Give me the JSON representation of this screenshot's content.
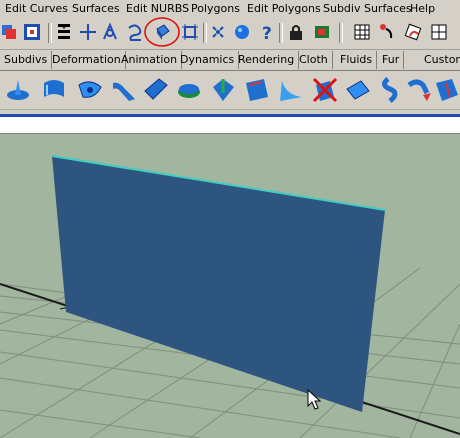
{
  "menu": {
    "items": [
      "Edit Curves",
      "Surfaces",
      "Edit NURBS",
      "Polygons",
      "Edit Polygons",
      "Subdiv Surfaces",
      "Help"
    ]
  },
  "shelf_tabs": [
    "Subdivs",
    "Deformation",
    "Animation",
    "Dynamics",
    "Rendering",
    "Cloth",
    "Fluids",
    "Fur",
    "Custom"
  ],
  "toolbar": {
    "icons": [
      "select-mode-icon",
      "hierarchy-mode-icon",
      "object-mode-icon",
      "pick-mask-icon",
      "snap-grid-icon",
      "snap-curve-icon",
      "snap-point-icon",
      "snap-view-plane-icon",
      "make-live-icon",
      "history-icon",
      "render-icon",
      "help-icon",
      "lock-icon",
      "ipr-render-icon",
      "render-settings-icon",
      "hypershade-icon",
      "shader-icon"
    ]
  },
  "shelf": {
    "icons": [
      "revolve-icon",
      "loft-icon",
      "planar-icon",
      "extrude-icon",
      "birail-icon",
      "boundary-icon",
      "square-icon",
      "bevel-icon",
      "bevel-plus-icon",
      "intersect-icon",
      "trim-icon",
      "untrim-icon",
      "attach-icon",
      "detach-icon",
      "align-icon",
      "open-close-icon"
    ]
  },
  "colors": {
    "accent": "#1f4db0",
    "viewport_bg": "#a2b59f",
    "plane_fill": "#2e5580",
    "plane_edge": "#3fcfc0",
    "highlight": "#e01010"
  }
}
